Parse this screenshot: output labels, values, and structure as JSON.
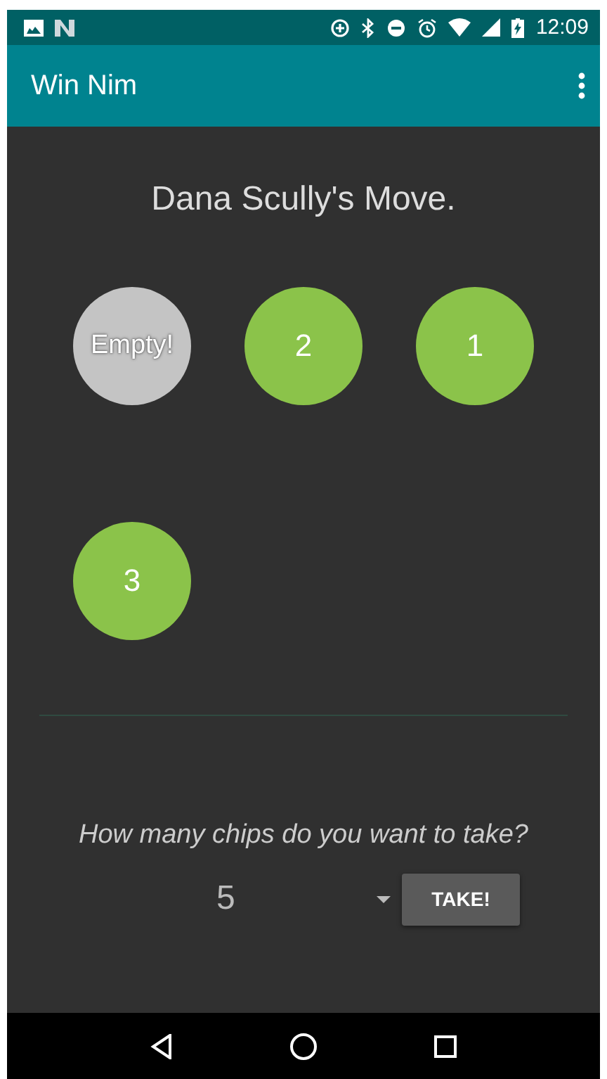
{
  "status_bar": {
    "time": "12:09"
  },
  "app_bar": {
    "title": "Win Nim"
  },
  "turn_text": "Dana Scully's Move.",
  "piles": [
    {
      "label": "Empty!",
      "empty": true
    },
    {
      "label": "2",
      "empty": false
    },
    {
      "label": "1",
      "empty": false
    },
    {
      "label": "3",
      "empty": false
    }
  ],
  "prompt": "How many chips do you want to take?",
  "spinner": {
    "value": "5"
  },
  "take_button": "TAKE!"
}
